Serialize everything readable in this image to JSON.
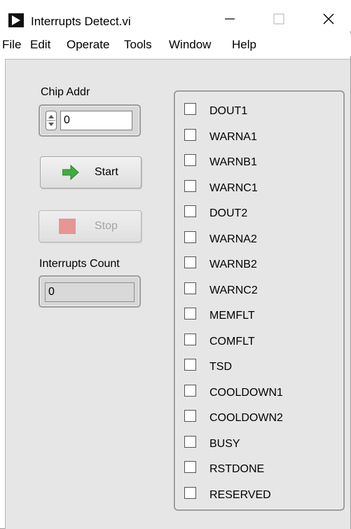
{
  "window": {
    "title": "Interrupts Detect.vi",
    "controls": {
      "minimize": "—",
      "maximize": "☐",
      "close": "✕"
    }
  },
  "menu": {
    "items": [
      "File",
      "Edit",
      "Operate",
      "Tools",
      "Window",
      "Help"
    ]
  },
  "panel": {
    "chip_addr_label": "Chip Addr",
    "chip_addr_value": "0",
    "start_label": "Start",
    "stop_label": "Stop",
    "interrupts_count_label": "Interrupts Count",
    "interrupts_count_value": "0"
  },
  "checkboxes": [
    "DOUT1",
    "WARNA1",
    "WARNB1",
    "WARNC1",
    "DOUT2",
    "WARNA2",
    "WARNB2",
    "WARNC2",
    "MEMFLT",
    "COMFLT",
    "TSD",
    "COOLDOWN1",
    "COOLDOWN2",
    "BUSY",
    "RSTDONE",
    "RESERVED"
  ],
  "colors": {
    "panel_bg": "#e6e6e6",
    "start_arrow": "#3fae3f",
    "stop_square": "#e87a7a"
  }
}
